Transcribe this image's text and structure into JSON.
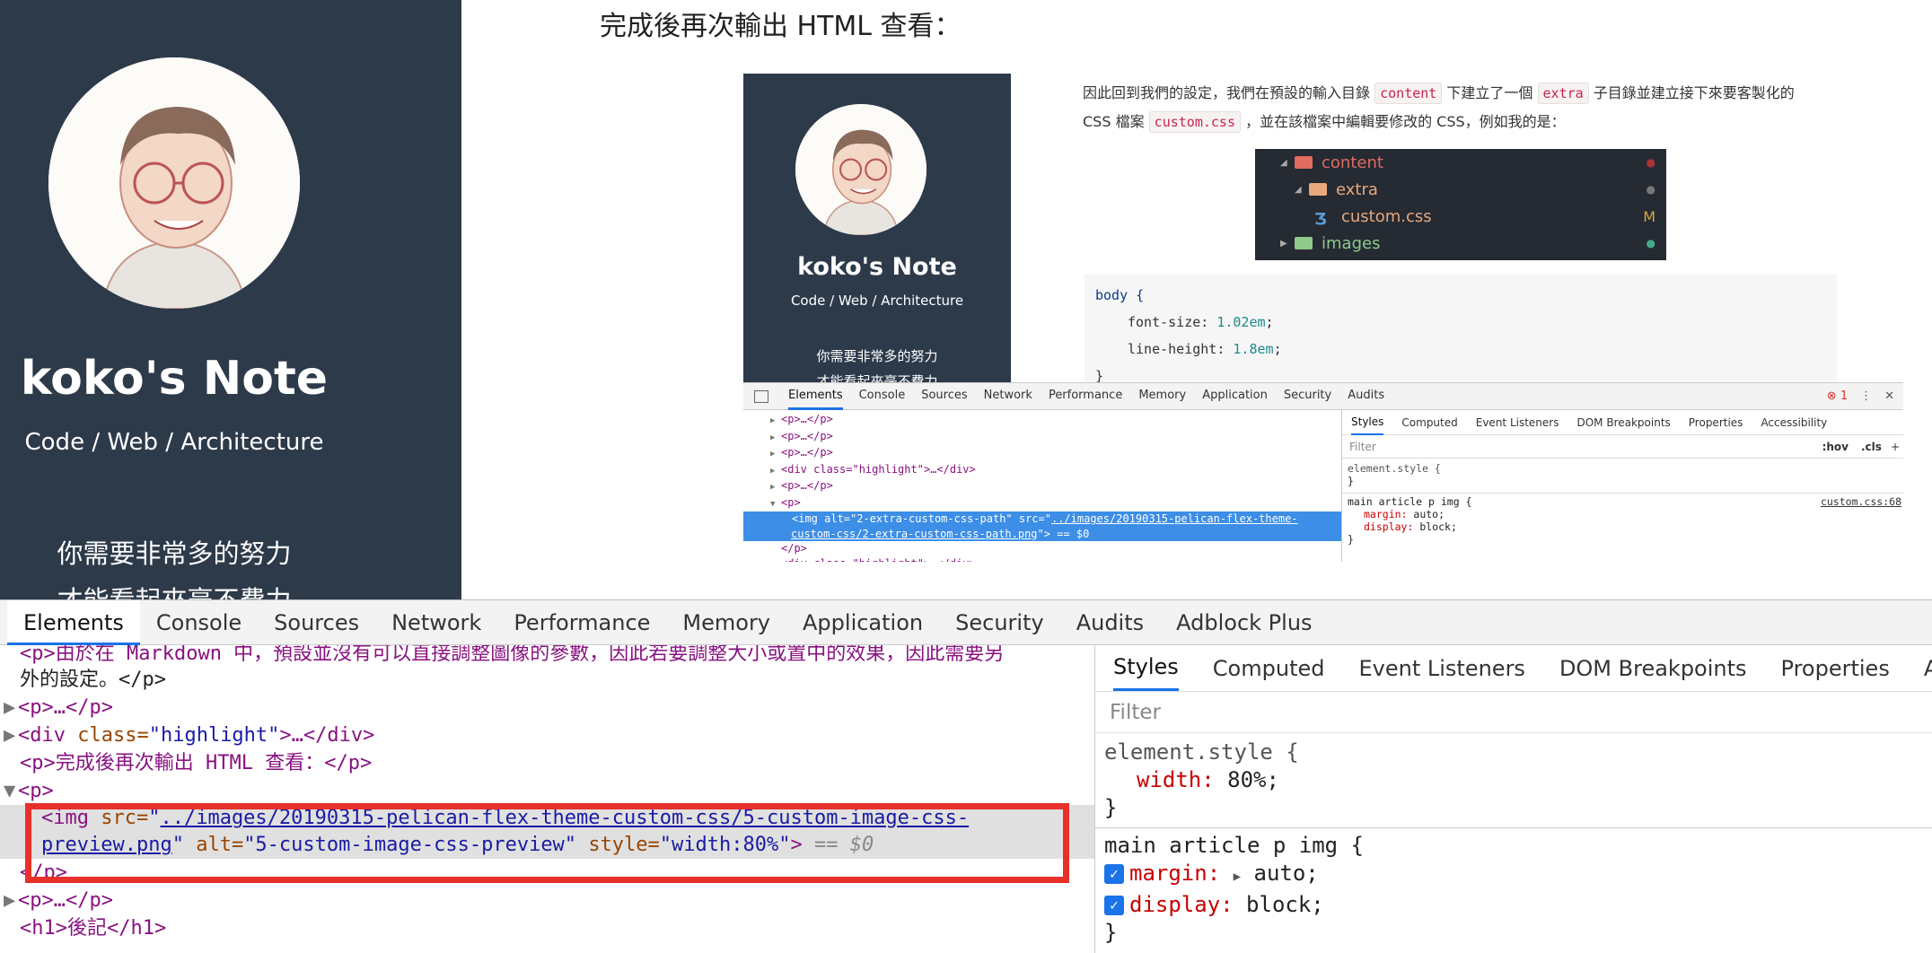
{
  "sidebar": {
    "title": "koko's Note",
    "subtitle": "Code / Web / Architecture",
    "quote1": "你需要非常多的努力",
    "quote2": "才能看起來毫不費力"
  },
  "article": {
    "heading": "完成後再次輸出 HTML 查看：",
    "para1_a": "因此回到我們的設定，我們在預設的輸入目錄",
    "code_content": "content",
    "para1_b": "下建立了一個",
    "code_extra": "extra",
    "para1_c": "子目錄並建立接下來要客製化的",
    "para2_a": "CSS 檔案",
    "code_custom": "custom.css",
    "para2_b": "，並在該檔案中編輯要修改的 CSS，例如我的是：",
    "preview": {
      "title": "koko's Note",
      "subtitle": "Code / Web / Architecture",
      "quote1": "你需要非常多的努力",
      "quote2": "才能看起來毫不費力"
    },
    "tree": {
      "items": [
        {
          "label": "content",
          "color": "#e06c5f",
          "badge": "●",
          "badge_color": "#a33"
        },
        {
          "label": "extra",
          "color": "#e8a87c",
          "badge": "●",
          "badge_color": "#777"
        },
        {
          "label": "custom.css",
          "color": "#e8a87c",
          "badge": "M",
          "badge_color": "#d4a84a"
        },
        {
          "label": "images",
          "color": "#8fc98b",
          "badge": "●",
          "badge_color": "#4a8"
        }
      ]
    },
    "code_block": [
      "body {",
      "font-size:",
      "1.02em",
      ";",
      "line-height:",
      "1.8em",
      ";",
      "}"
    ]
  },
  "small_devtools": {
    "tabs": [
      "Elements",
      "Console",
      "Sources",
      "Network",
      "Performance",
      "Memory",
      "Application",
      "Security",
      "Audits"
    ],
    "error_count": "1",
    "lines": [
      "<p>…</p>",
      "<p>…</p>",
      "<p>…</p>",
      "<div class=\"highlight\">…</div>",
      "<p>…</p>",
      "<p>"
    ],
    "sel_line1_pre": "<img alt=\"2-extra-custom-css-path\" src=\"",
    "sel_link1": "../images/20190315-pelican-flex-theme-",
    "sel_line2_link": "custom-css/2-extra-custom-css-path.png",
    "sel_line2_post": "\"> == $0",
    "after": [
      "</p>",
      "<div class=\"highlight\">…</div>"
    ],
    "style_tabs": [
      "Styles",
      "Computed",
      "Event Listeners",
      "DOM Breakpoints",
      "Properties",
      "Accessibility"
    ],
    "filter": "Filter",
    "hov": ":hov",
    ".cls": ".cls",
    "element_style": "element.style {",
    "close": "}",
    "rule_selector": "main article p img {",
    "rule_source": "custom.css:68",
    "margin": "margin:",
    "margin_val": "auto;",
    "display": "display:",
    "display_val": "block;"
  },
  "devtools": {
    "tabs": [
      "Elements",
      "Console",
      "Sources",
      "Network",
      "Performance",
      "Memory",
      "Application",
      "Security",
      "Audits",
      "Adblock Plus"
    ],
    "line1": "<p>由於在 Markdown 中，預設並沒有可以直接調整圖像的參數，因此若要調整大小或置中的效果，因此需要另",
    "line1b": "外的設定。</p>",
    "line2": "<p>…</p>",
    "line3_tag": "<div",
    "line3_attr": "class=",
    "line3_val": "\"highlight\"",
    "line3_end": ">…</div>",
    "line4": "<p>完成後再次輸出 HTML 查看：</p>",
    "line5": "<p>",
    "img_open": "<img",
    "src_attr": "src=",
    "src_q": "\"",
    "src_link1": "../images/20190315-pelican-flex-theme-custom-css/5-custom-image-css-",
    "src_link2": "preview.png",
    "alt_attr": "alt=",
    "alt_val": "\"5-custom-image-css-preview\"",
    "style_attr": "style=",
    "style_val": "\"width:80%\"",
    "img_close": ">",
    "eq": "== $0",
    "line7": "</p>",
    "line8": "<p>…</p>",
    "line9": "<h1>後記</h1>",
    "style_tabs": [
      "Styles",
      "Computed",
      "Event Listeners",
      "DOM Breakpoints",
      "Properties",
      "Accessibility"
    ],
    "filter_placeholder": "Filter",
    "element_style": "element.style {",
    "width_prop": "width:",
    "width_val": "80%;",
    "close": "}",
    "rule_selector": "main article p img {",
    "margin": "margin:",
    "margin_val": "auto;",
    "display": "display:",
    "display_val": "block;"
  },
  "colors": {
    "sidebar": "#2d3a4a",
    "highlight_box": "#e8302a",
    "selected_row": "#3d8ee6"
  }
}
